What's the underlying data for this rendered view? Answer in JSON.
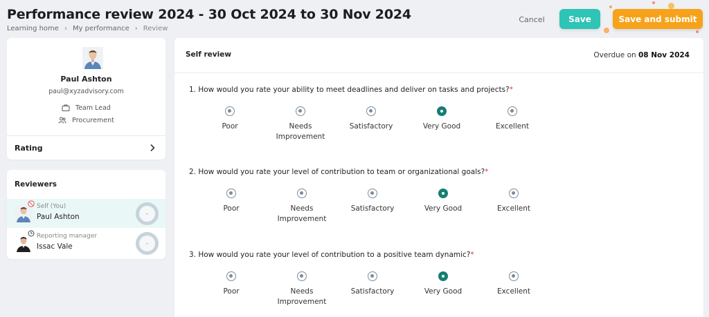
{
  "header": {
    "title": "Performance review 2024 - 30 Oct 2024 to 30 Nov 2024",
    "breadcrumb": [
      "Learning home",
      "My performance",
      "Review"
    ],
    "cancel_label": "Cancel",
    "save_label": "Save",
    "submit_label": "Save and submit"
  },
  "colors": {
    "accent_teal": "#2ec4b6",
    "accent_orange": "#f7a21b",
    "selected_radio": "#157f72",
    "required_marker": "#e53935"
  },
  "profile": {
    "name": "Paul Ashton",
    "email": "paul@xyzadvisory.com",
    "role": "Team Lead",
    "department": "Procurement",
    "role_icon": "briefcase-icon",
    "department_icon": "people-icon"
  },
  "rating": {
    "label": "Rating"
  },
  "reviewers": {
    "title": "Reviewers",
    "items": [
      {
        "role": "Self (You)",
        "name": "Paul Ashton",
        "score": "-"
      },
      {
        "role": "Reporting manager",
        "name": "Issac Vale",
        "score": "-"
      }
    ]
  },
  "review": {
    "section_title": "Self review",
    "overdue_prefix": "Overdue on",
    "overdue_date": "08 Nov 2024",
    "options": [
      "Poor",
      "Needs Improvement",
      "Satisfactory",
      "Very Good",
      "Excellent"
    ],
    "questions": [
      {
        "text": "1. How would you rate your ability to meet deadlines and deliver on tasks and projects?",
        "required": "*",
        "selected": "Very Good"
      },
      {
        "text": "2. How would you rate your level of contribution to team or organizational goals?",
        "required": "*",
        "selected": "Very Good"
      },
      {
        "text": "3. How would you rate your level of contribution to a positive team dynamic?",
        "required": "*",
        "selected": "Very Good"
      }
    ]
  }
}
